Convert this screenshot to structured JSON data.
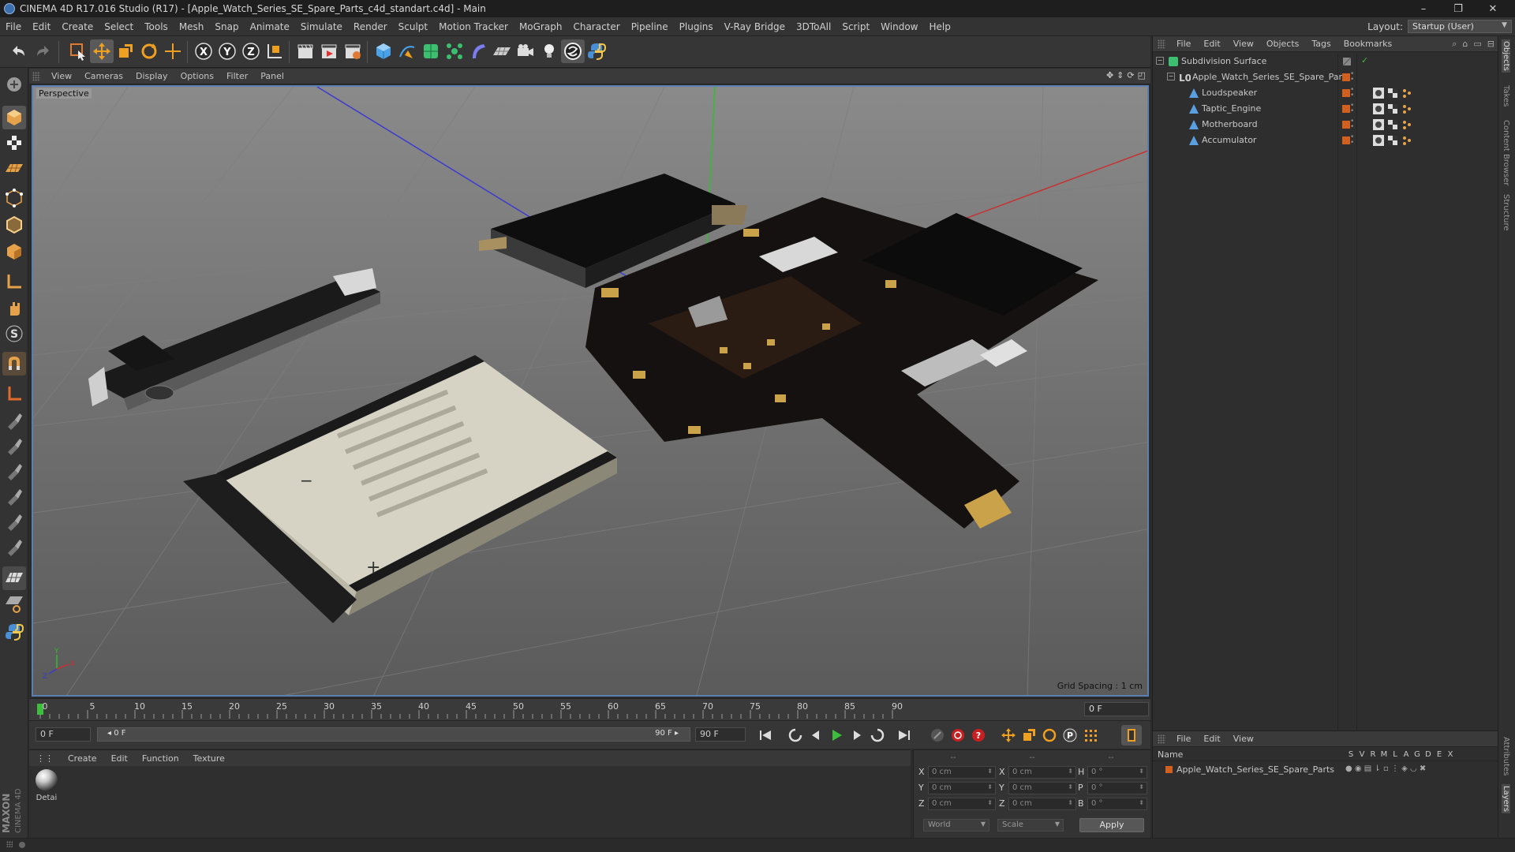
{
  "window": {
    "title": "CINEMA 4D R17.016 Studio (R17) - [Apple_Watch_Series_SE_Spare_Parts_c4d_standart.c4d] - Main",
    "controls": [
      "–",
      "❐",
      "✕"
    ]
  },
  "menu": [
    "File",
    "Edit",
    "Create",
    "Select",
    "Tools",
    "Mesh",
    "Snap",
    "Animate",
    "Simulate",
    "Render",
    "Sculpt",
    "Motion Tracker",
    "MoGraph",
    "Character",
    "Pipeline",
    "Plugins",
    "V-Ray Bridge",
    "3DToAll",
    "Script",
    "Window",
    "Help"
  ],
  "layout": {
    "label": "Layout:",
    "value": "Startup (User)"
  },
  "toolbar": {
    "buttons": [
      "undo",
      "redo",
      "live-selection",
      "move",
      "scale",
      "rotate",
      "multi-transform",
      "x-axis",
      "y-axis",
      "z-axis",
      "world-coordinates",
      "render-view",
      "render-to-picture-viewer",
      "edit-render-settings",
      "cube",
      "pen-spline",
      "subdivision-surface",
      "cloner",
      "deformer",
      "floor",
      "camera",
      "light",
      "sketch",
      "python"
    ],
    "axis_labels": {
      "x": "X",
      "y": "Y",
      "z": "Z"
    }
  },
  "viewport": {
    "menu": [
      "View",
      "Cameras",
      "Display",
      "Options",
      "Filter",
      "Panel"
    ],
    "label": "Perspective",
    "grid_spacing": "Grid Spacing : 1 cm",
    "axis_labels": {
      "y": "Y",
      "x": "X",
      "z": "Z"
    },
    "battery_label_char": "+",
    "battery_minus_char": "−"
  },
  "timeline": {
    "ticks": [
      "0",
      "5",
      "10",
      "15",
      "20",
      "25",
      "30",
      "35",
      "40",
      "45",
      "50",
      "55",
      "60",
      "65",
      "70",
      "75",
      "80",
      "85",
      "90"
    ],
    "current_frame": "0 F"
  },
  "transport": {
    "start_field": "0 F",
    "range_left": "◂ 0 F",
    "range_right": "90 F ▸",
    "end_field": "90 F"
  },
  "materials": {
    "menu": [
      "Create",
      "Edit",
      "Function",
      "Texture"
    ],
    "items": [
      {
        "name": "Detai"
      }
    ]
  },
  "coordinates": {
    "headers": [
      "--",
      "--",
      "--"
    ],
    "rows": [
      {
        "axis": "X",
        "pos": "0 cm",
        "axis2": "X",
        "size": "0 cm",
        "rot_label": "H",
        "rot": "0 °"
      },
      {
        "axis": "Y",
        "pos": "0 cm",
        "axis2": "Y",
        "size": "0 cm",
        "rot_label": "P",
        "rot": "0 °"
      },
      {
        "axis": "Z",
        "pos": "0 cm",
        "axis2": "Z",
        "size": "0 cm",
        "rot_label": "B",
        "rot": "0 °"
      }
    ],
    "space": "World",
    "mode": "Scale",
    "apply_label": "Apply"
  },
  "object_manager": {
    "menu": [
      "File",
      "Edit",
      "View",
      "Objects",
      "Tags",
      "Bookmarks"
    ],
    "objects": [
      {
        "name": "Subdivision Surface",
        "level": 0,
        "expand": "−"
      },
      {
        "name": "Apple_Watch_Series_SE_Spare_Parts",
        "level": 1,
        "expand": "−"
      },
      {
        "name": "Loudspeaker",
        "level": 2
      },
      {
        "name": "Taptic_Engine",
        "level": 2
      },
      {
        "name": "Motherboard",
        "level": 2
      },
      {
        "name": "Accumulator",
        "level": 2
      }
    ],
    "layer_color": "#d35f1f"
  },
  "layer_manager": {
    "menu": [
      "File",
      "Edit",
      "View"
    ],
    "columns": [
      "S",
      "V",
      "R",
      "M",
      "L",
      "A",
      "G",
      "D",
      "E",
      "X"
    ],
    "name_header": "Name",
    "layers": [
      {
        "name": "Apple_Watch_Series_SE_Spare_Parts"
      }
    ]
  },
  "side_tabs": [
    "Objects",
    "Takes",
    "Content Browser",
    "Structure",
    "Attributes",
    "Layers"
  ],
  "brand": {
    "maxon": "MAXON",
    "cinema": "CINEMA 4D"
  }
}
